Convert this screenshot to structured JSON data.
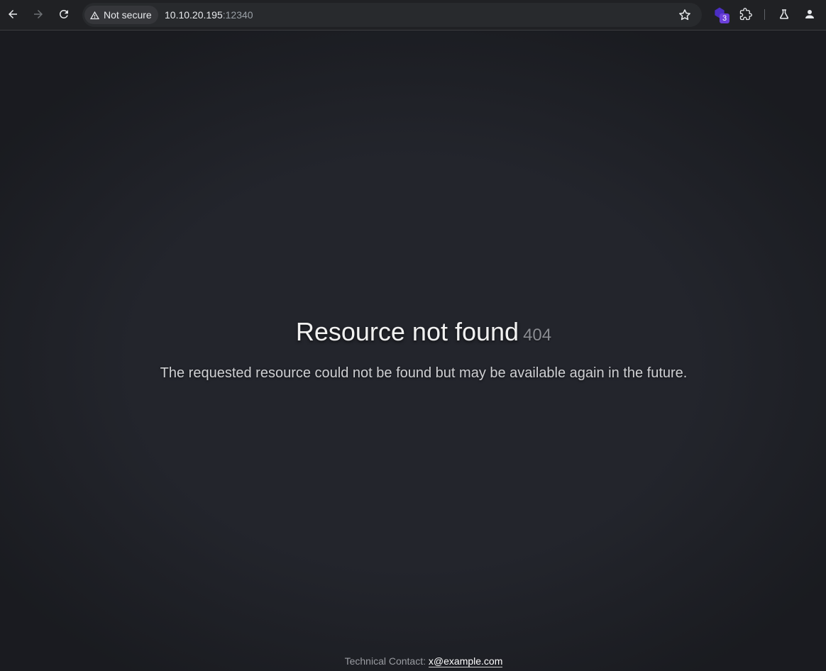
{
  "browser": {
    "security_label": "Not secure",
    "url_host": "10.10.20.195",
    "url_port": ":12340",
    "extension_badge_count": "3",
    "icons": [
      "back-icon",
      "forward-icon",
      "reload-icon",
      "warning-icon",
      "star-icon",
      "extension-icon",
      "puzzle-icon",
      "lab-icon",
      "profile-icon"
    ]
  },
  "page": {
    "title": "Resource not found",
    "code": "404",
    "description": "The requested resource could not be found but may be available again in the future.",
    "footer_label": "Technical Contact:",
    "contact_email": "x@example.com"
  }
}
